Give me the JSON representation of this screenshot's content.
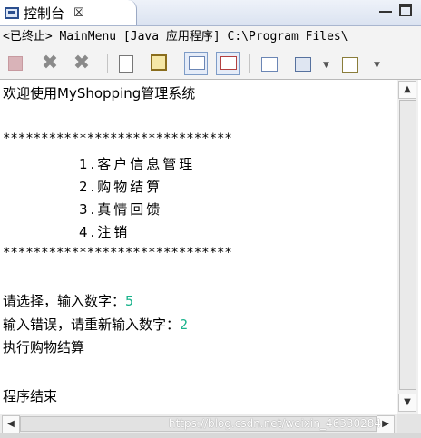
{
  "tab": {
    "title": "控制台",
    "close": "☒"
  },
  "process_line": "<已终止> MainMenu [Java 应用程序] C:\\Program Files\\",
  "console": {
    "welcome": "欢迎使用MyShopping管理系统",
    "stars": "******************************",
    "menu": [
      "1.客户信息管理",
      "2.购物结算",
      "3.真情回馈",
      "4.注销"
    ],
    "prompt_select": "请选择，输入数字：",
    "input_1": "5",
    "prompt_error": "输入错误，请重新输入数字：",
    "input_2": "2",
    "exec": "执行购物结算",
    "end": "程序结束"
  },
  "watermark": "https://blog.csdn.net/weixin_46330284",
  "icons": [
    "console-icon",
    "terminate-icon",
    "remove-launch-icon",
    "remove-all-icon",
    "clear-console-icon",
    "scroll-lock-icon",
    "pin-console-icon",
    "show-console-icon",
    "new-console-icon",
    "display-console-icon",
    "open-console-icon"
  ]
}
